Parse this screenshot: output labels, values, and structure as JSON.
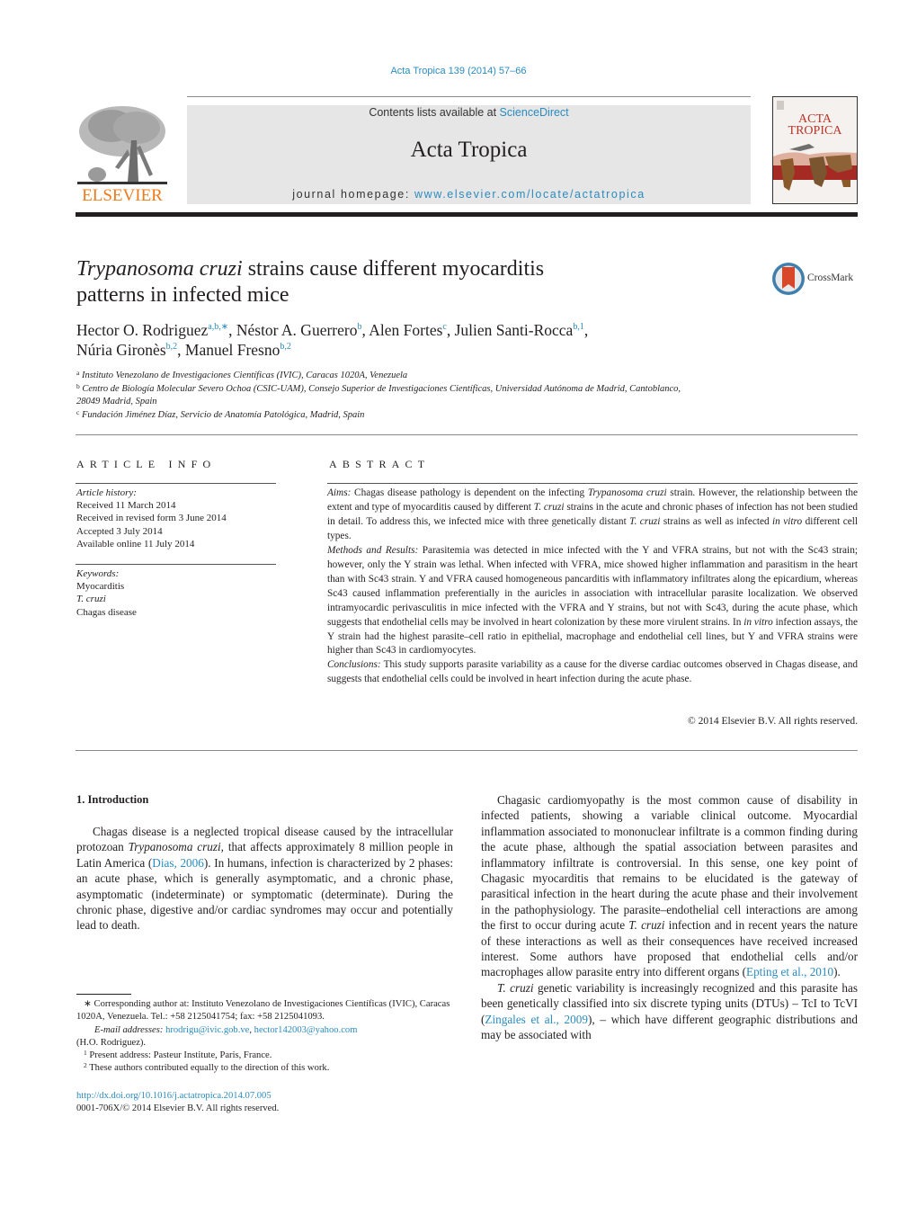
{
  "header": {
    "citation": "Acta Tropica 139 (2014) 57–66",
    "contents_prefix": "Contents lists available at ",
    "contents_link": "ScienceDirect",
    "journal_name": "Acta Tropica",
    "homepage_prefix": "journal homepage: ",
    "homepage_link": "www.elsevier.com/locate/actatropica",
    "publisher_logo_text": "ELSEVIER",
    "cover_title_line1": "ACTA",
    "cover_title_line2": "TROPICA",
    "crossmark_label": "CrossMark",
    "colors": {
      "link": "#2a8bbf",
      "elsevier_orange": "#f07a1a",
      "banner_bg": "#e6e6e6",
      "crossmark_red": "#d9472b"
    }
  },
  "article": {
    "title_italic": "Trypanosoma cruzi",
    "title_rest_line1": " strains cause different myocarditis",
    "title_line2": "patterns in infected mice",
    "authors": [
      {
        "name": "Hector O. Rodriguez",
        "sup": "a,b,∗",
        "sep": ", "
      },
      {
        "name": "Néstor A. Guerrero",
        "sup": "b",
        "sep": ", "
      },
      {
        "name": "Alen Fortes",
        "sup": "c",
        "sep": ", "
      },
      {
        "name": "Julien Santi-Rocca",
        "sup": "b,1",
        "sep": ","
      },
      {
        "name": "Núria Gironès",
        "sup": "b,2",
        "sep": ", "
      },
      {
        "name": "Manuel Fresno",
        "sup": "b,2",
        "sep": ""
      }
    ],
    "affiliations": [
      {
        "label": "a",
        "text": "Instituto Venezolano de Investigaciones Científicas (IVIC), Caracas 1020A, Venezuela"
      },
      {
        "label": "b",
        "text": "Centro de Biología Molecular Severo Ochoa (CSIC-UAM), Consejo Superior de Investigaciones Científicas, Universidad Autónoma de Madrid, Cantoblanco,",
        "text2": "28049 Madrid, Spain"
      },
      {
        "label": "c",
        "text": "Fundación Jiménez Díaz, Servicio de Anatomía Patológica, Madrid, Spain"
      }
    ]
  },
  "article_info": {
    "heading": "ARTICLE INFO",
    "history_label": "Article history:",
    "history": [
      "Received 11 March 2014",
      "Received in revised form 3 June 2014",
      "Accepted 3 July 2014",
      "Available online 11 July 2014"
    ],
    "keywords_label": "Keywords:",
    "keywords": [
      "Myocarditis",
      "T. cruzi",
      "Chagas disease"
    ]
  },
  "abstract": {
    "heading": "ABSTRACT",
    "aims_label": "Aims:",
    "aims_1": " Chagas disease pathology is dependent on the infecting ",
    "aims_it1": "Trypanosoma cruzi",
    "aims_2": " strain. However, the relationship between the extent and type of myocarditis caused by different ",
    "aims_it2": "T. cruzi",
    "aims_3": " strains in the acute and chronic phases of infection has not been studied in detail. To address this, we infected mice with three genetically distant ",
    "aims_it3": "T. cruzi",
    "aims_4": " strains as well as infected ",
    "aims_it4": "in vitro",
    "aims_5": " different cell types.",
    "methods_label": "Methods and Results:",
    "methods_1": " Parasitemia was detected in mice infected with the Y and VFRA strains, but not with the Sc43 strain; however, only the Y strain was lethal. When infected with VFRA, mice showed higher inflammation and parasitism in the heart than with Sc43 strain. Y and VFRA caused homogeneous pancarditis with inflammatory infiltrates along the epicardium, whereas Sc43 caused inflammation preferentially in the auricles in association with intracellular parasite localization. We observed intramyocardic perivasculitis in mice infected with the VFRA and Y strains, but not with Sc43, during the acute phase, which suggests that endothelial cells may be involved in heart colonization by these more virulent strains. In ",
    "methods_it1": "in vitro",
    "methods_2": " infection assays, the Y strain had the highest parasite–cell ratio in epithelial, macrophage and endothelial cell lines, but Y and VFRA strains were higher than Sc43 in cardiomyocytes.",
    "conclusions_label": "Conclusions:",
    "conclusions_1": " This study supports parasite variability as a cause for the diverse cardiac outcomes observed in Chagas disease, and suggests that endothelial cells could be involved in heart infection during the acute phase.",
    "copyright": "© 2014 Elsevier B.V. All rights reserved."
  },
  "introduction": {
    "heading": "1.  Introduction",
    "p1_1": "Chagas disease is a neglected tropical disease caused by the intracellular protozoan ",
    "p1_it1": "Trypanosoma cruzi",
    "p1_2": ", that affects approximately 8 million people in Latin America (",
    "p1_ref1": "Dias, 2006",
    "p1_3": "). In humans, infection is characterized by 2 phases: an acute phase, which is generally asymptomatic, and a chronic phase, asymptomatic (indeterminate) or symptomatic (determinate). During the chronic phase, digestive and/or cardiac syndromes may occur and potentially lead to death.",
    "p2_1": "Chagasic cardiomyopathy is the most common cause of disability in infected patients, showing a variable clinical outcome. Myocardial inflammation associated to mononuclear infiltrate is a common finding during the acute phase, although the spatial association between parasites and inflammatory infiltrate is controversial. In this sense, one key point of Chagasic myocarditis that remains to be elucidated is the gateway of parasitical infection in the heart during the acute phase and their involvement in the pathophysiology. The parasite–endothelial cell interactions are among the first to occur during acute ",
    "p2_it1": "T. cruzi",
    "p2_2": " infection and in recent years the nature of these interactions as well as their consequences have received increased interest. Some authors have proposed that endothelial cells and/or macrophages allow parasite entry into different organs (",
    "p2_ref1": "Epting et al., 2010",
    "p2_3": ").",
    "p3_it1": "T. cruzi",
    "p3_1": " genetic variability is increasingly recognized and this parasite has been genetically classified into six discrete typing units (DTUs) – TcI to TcVI (",
    "p3_ref1": "Zingales et al., 2009",
    "p3_2": "), – which have different geographic distributions and may be associated with"
  },
  "footnotes": {
    "corr_mark": "∗",
    "corr_text": " Corresponding author at: Instituto Venezolano de Investigaciones Científicas (IVIC), Caracas 1020A, Venezuela. Tel.: +58 2125041754; fax: +58 2125041093.",
    "email_label": "E-mail addresses:",
    "email1": "hrodrigu@ivic.gob.ve",
    "email_sep": ", ",
    "email2": "hector142003@yahoo.com",
    "email_owner": "(H.O. Rodriguez).",
    "fn1_mark": "1",
    "fn1_text": " Present address: Pasteur Institute, Paris, France.",
    "fn2_mark": "2",
    "fn2_text": " These authors contributed equally to the direction of this work.",
    "doi": "http://dx.doi.org/10.1016/j.actatropica.2014.07.005",
    "issn": "0001-706X/© 2014 Elsevier B.V. All rights reserved."
  }
}
